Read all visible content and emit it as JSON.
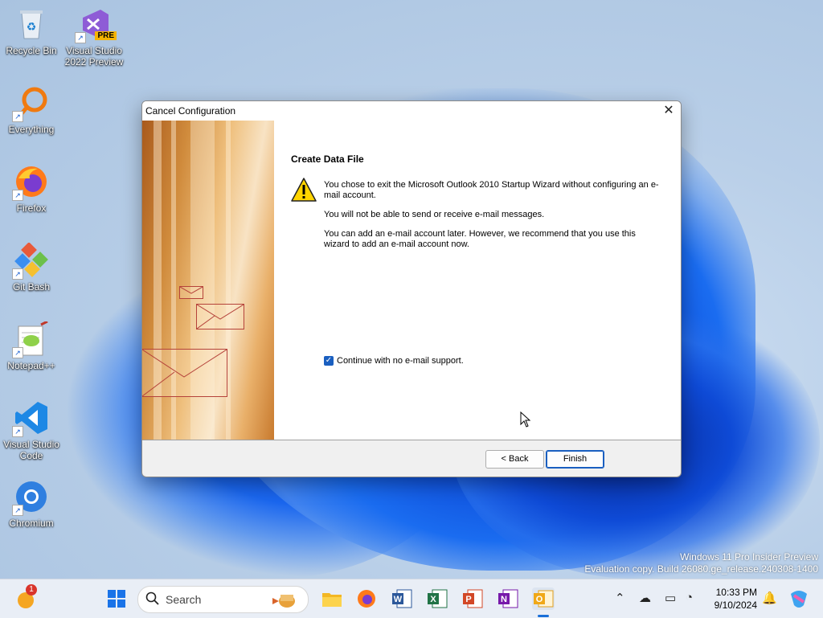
{
  "desktop": {
    "icons": [
      {
        "label": "Recycle Bin"
      },
      {
        "label": "Visual Studio 2022 Preview",
        "badge": "PRE"
      },
      {
        "label": "Everything"
      },
      {
        "label": "Firefox"
      },
      {
        "label": "Git Bash"
      },
      {
        "label": "Notepad++"
      },
      {
        "label": "Visual Studio Code"
      },
      {
        "label": "Chromium"
      }
    ],
    "watermark": {
      "line1": "Windows 11 Pro Insider Preview",
      "line2": "Evaluation copy. Build 26080.ge_release.240308-1400"
    }
  },
  "dialog": {
    "title": "Cancel Configuration",
    "close_glyph": "✕",
    "heading": "Create Data File",
    "para1": "You chose to exit the Microsoft Outlook 2010 Startup Wizard without configuring an e-mail account.",
    "para2": "You will not be able to send or receive e-mail messages.",
    "para3": "You can add an e-mail account later. However, we recommend that you use this wizard to add an e-mail account now.",
    "checkbox": {
      "label": "Continue with no e-mail support.",
      "checked": true
    },
    "back_label": "< Back",
    "finish_label": "Finish"
  },
  "taskbar": {
    "search_placeholder": "Search",
    "notification_count": "1",
    "time": "10:33 PM",
    "date": "9/10/2024",
    "apps": [
      "start-icon",
      "file-explorer-icon",
      "firefox-icon",
      "word-icon",
      "excel-icon",
      "powerpoint-icon",
      "onenote-icon",
      "outlook-icon"
    ]
  },
  "colors": {
    "accent": "#1a5fc0",
    "taskbar_bg": "#e9eef6"
  }
}
